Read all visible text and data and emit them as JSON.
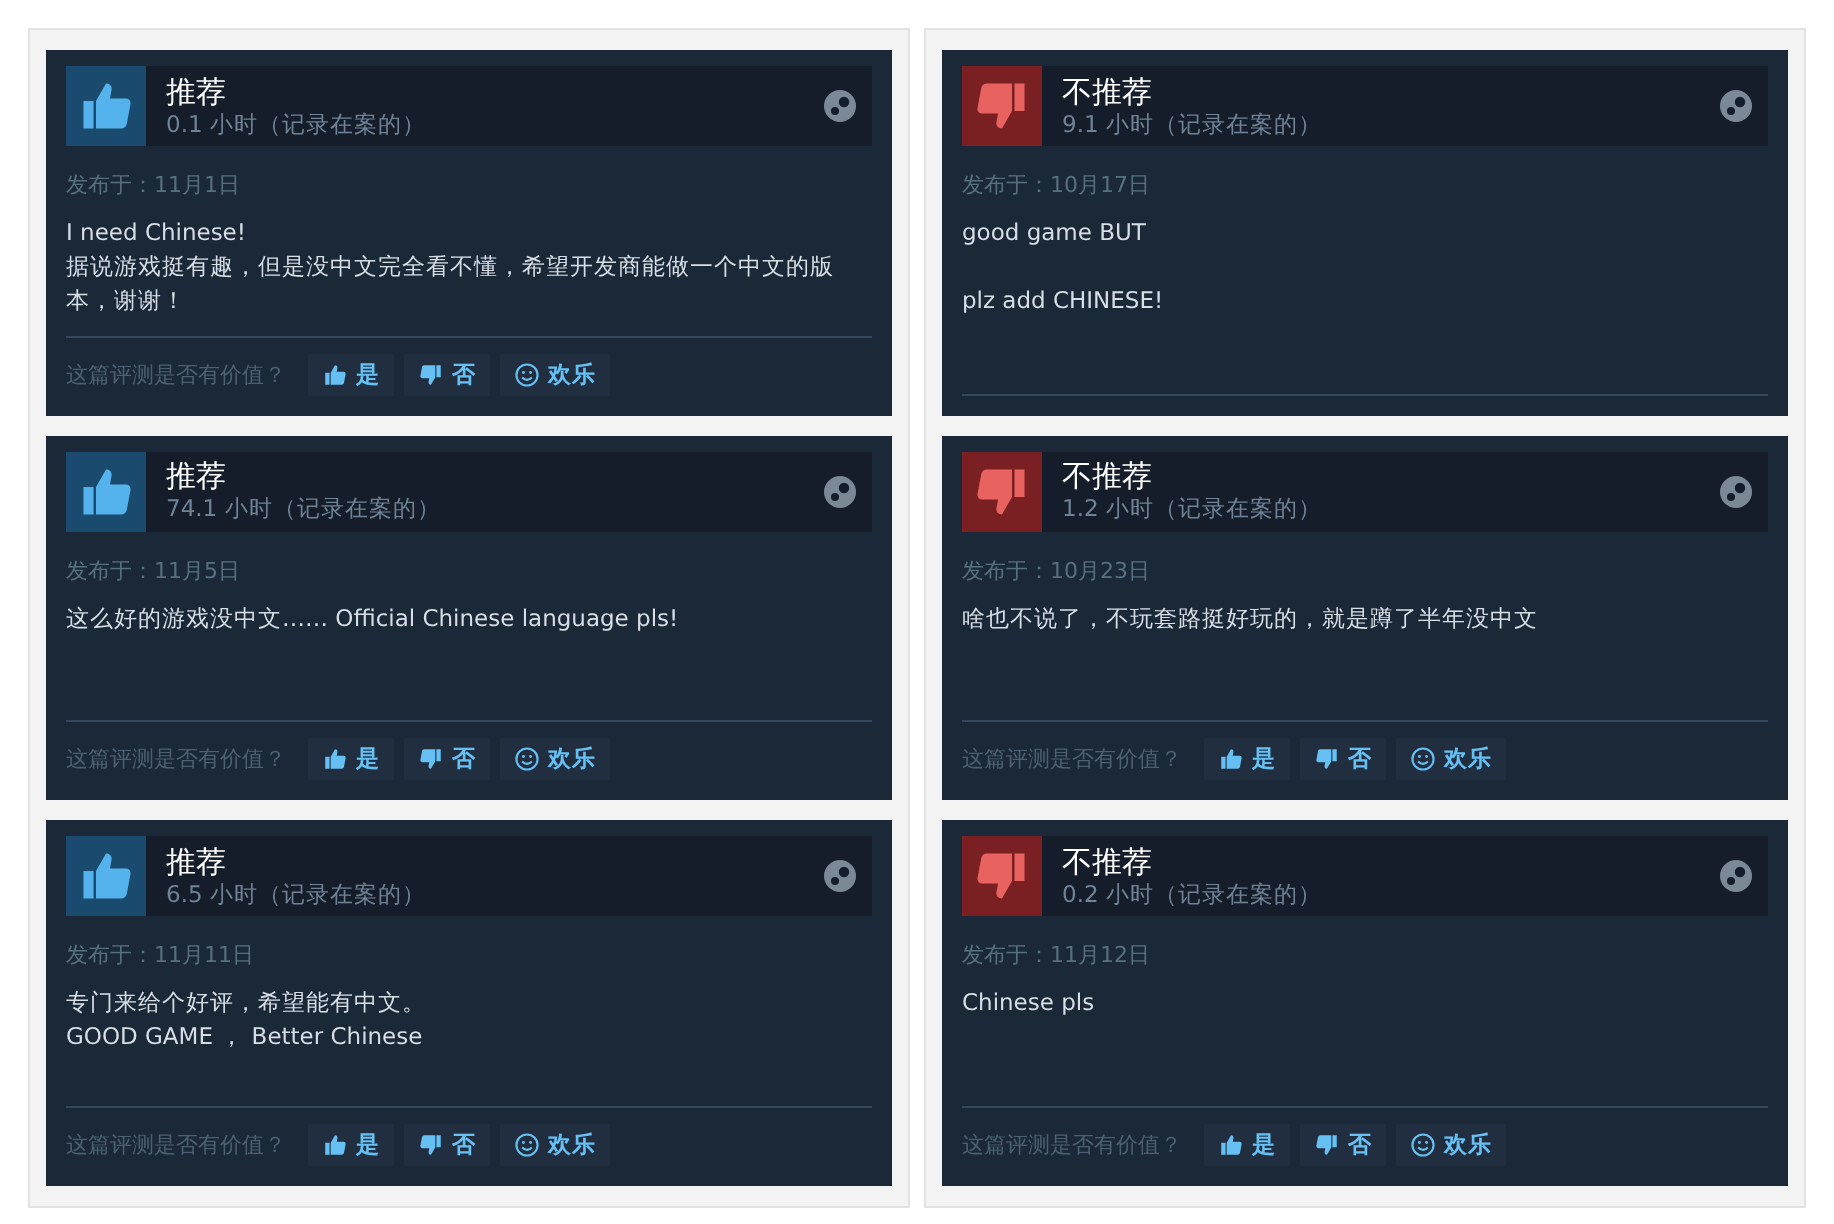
{
  "columns": [
    {
      "reviews": [
        {
          "kind": "positive",
          "title": "推荐",
          "hours": "0.1 小时（记录在案的）",
          "date": "发布于：11月1日",
          "body": "I need Chinese!\n据说游戏挺有趣，但是没中文完全看不懂，希望开发商能做一个中文的版本，谢谢！",
          "question": "这篇评测是否有价值？",
          "buttons": [
            {
              "kind": "yes",
              "label": "是"
            },
            {
              "kind": "no",
              "label": "否"
            },
            {
              "kind": "funny",
              "label": "欢乐"
            }
          ]
        },
        {
          "kind": "positive",
          "title": "推荐",
          "hours": "74.1 小时（记录在案的）",
          "date": "发布于：11月5日",
          "body": "这么好的游戏没中文…… Official Chinese language pls!",
          "question": "这篇评测是否有价值？",
          "buttons": [
            {
              "kind": "yes",
              "label": "是"
            },
            {
              "kind": "no",
              "label": "否"
            },
            {
              "kind": "funny",
              "label": "欢乐"
            }
          ]
        },
        {
          "kind": "positive",
          "title": "推荐",
          "hours": "6.5 小时（记录在案的）",
          "date": "发布于：11月11日",
          "body": "专门来给个好评，希望能有中文。\nGOOD GAME ， Better Chinese",
          "question": "这篇评测是否有价值？",
          "buttons": [
            {
              "kind": "yes",
              "label": "是"
            },
            {
              "kind": "no",
              "label": "否"
            },
            {
              "kind": "funny",
              "label": "欢乐"
            }
          ]
        }
      ]
    },
    {
      "reviews": [
        {
          "kind": "negative",
          "title": "不推荐",
          "hours": "9.1 小时（记录在案的）",
          "date": "发布于：10月17日",
          "body": "good game BUT\n\nplz add CHINESE!"
        },
        {
          "kind": "negative",
          "title": "不推荐",
          "hours": "1.2 小时（记录在案的）",
          "date": "发布于：10月23日",
          "body": "啥也不说了，不玩套路挺好玩的，就是蹲了半年没中文",
          "question": "这篇评测是否有价值？",
          "buttons": [
            {
              "kind": "yes",
              "label": "是"
            },
            {
              "kind": "no",
              "label": "否"
            },
            {
              "kind": "funny",
              "label": "欢乐"
            }
          ]
        },
        {
          "kind": "negative",
          "title": "不推荐",
          "hours": "0.2 小时（记录在案的）",
          "date": "发布于：11月12日",
          "body": "Chinese pls",
          "question": "这篇评测是否有价值？",
          "buttons": [
            {
              "kind": "yes",
              "label": "是"
            },
            {
              "kind": "no",
              "label": "否"
            },
            {
              "kind": "funny",
              "label": "欢乐"
            }
          ]
        }
      ]
    }
  ]
}
